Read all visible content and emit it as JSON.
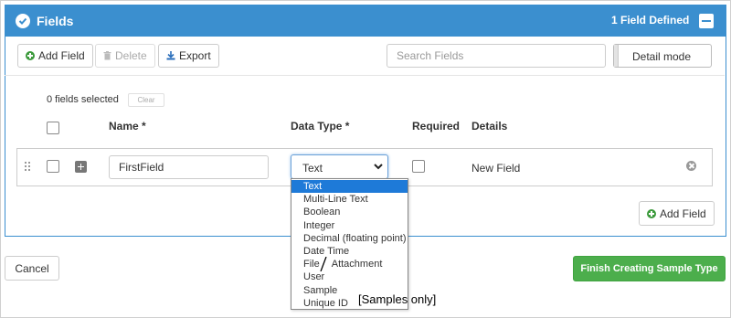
{
  "panel": {
    "title": "Fields",
    "count_label": "1 Field Defined"
  },
  "toolbar": {
    "add_field_label": "Add Field",
    "delete_label": "Delete",
    "export_label": "Export",
    "search_placeholder": "Search Fields",
    "mode_label": "Detail mode"
  },
  "selection": {
    "count_label": "0 fields selected",
    "clear_label": "Clear"
  },
  "columns": {
    "name": "Name *",
    "data_type": "Data Type *",
    "required": "Required",
    "details": "Details"
  },
  "field_row": {
    "name_value": "FirstField",
    "data_type_value": "Text",
    "details": "New Field"
  },
  "data_type_options": [
    "Text",
    "Multi-Line Text",
    "Boolean",
    "Integer",
    "Decimal (floating point)",
    "Date Time",
    "File",
    "Attachment",
    "User",
    "Sample",
    "Unique ID"
  ],
  "annotation_note": "[Samples only]",
  "footer": {
    "add_field_label": "Add Field",
    "cancel_label": "Cancel",
    "finish_label": "Finish Creating Sample Type"
  },
  "colors": {
    "header_blue": "#3b8fcf",
    "success_green": "#4cae4c",
    "option_highlight": "#1e7ad8"
  }
}
